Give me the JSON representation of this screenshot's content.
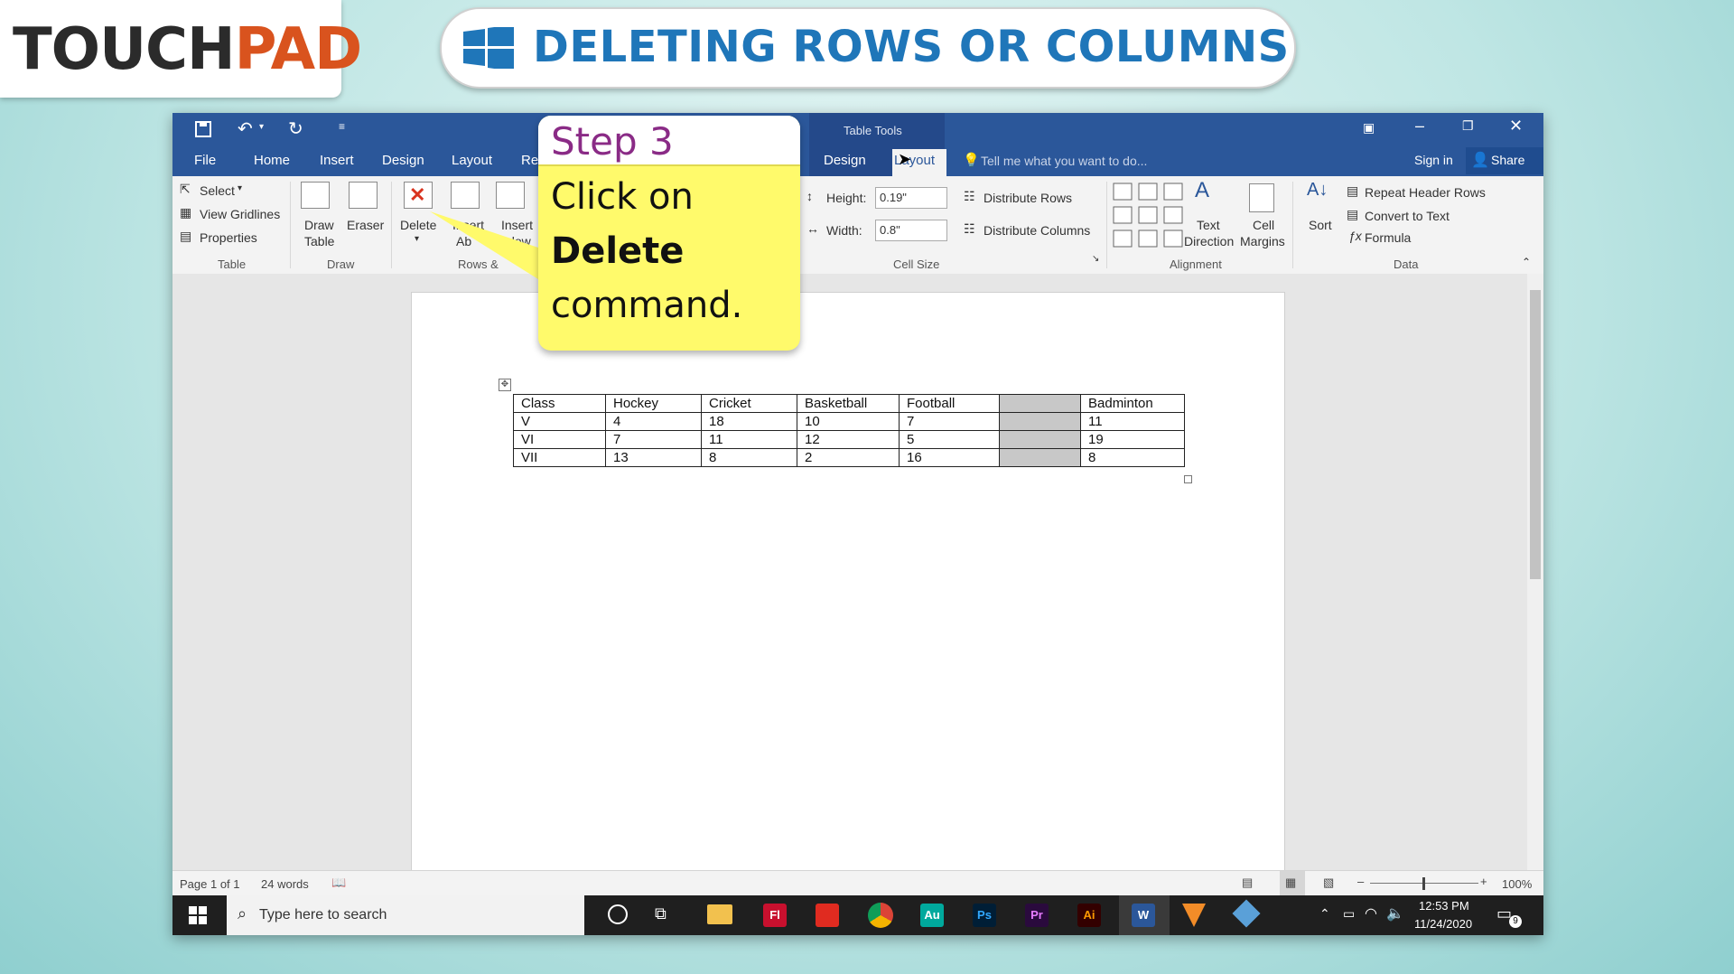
{
  "header": {
    "logo_part1": "TOUCH",
    "logo_part2": "PAD",
    "title": "DELETING ROWS OR COLUMNS"
  },
  "callout": {
    "step": "Step 3",
    "line1": "Click on",
    "line2": "Delete",
    "line3": "command."
  },
  "word": {
    "tabs": [
      "File",
      "Home",
      "Insert",
      "Design",
      "Layout",
      "Re"
    ],
    "table_tools": "Table Tools",
    "tt_tabs": [
      "Design",
      "Layout"
    ],
    "tell_me": "Tell me what you want to do...",
    "sign_in": "Sign in",
    "share": "Share",
    "ribbon": {
      "select": "Select",
      "view_gridlines": "View Gridlines",
      "properties": "Properties",
      "group_table": "Table",
      "draw_table_1": "Draw",
      "draw_table_2": "Table",
      "eraser": "Eraser",
      "group_draw": "Draw",
      "delete": "Delete",
      "insert_above_1": "Insert",
      "insert_above_2": "Ab",
      "insert_below_1": "Insert",
      "insert_below_2": "elow",
      "group_rows": "Rows &",
      "height_label": "Height:",
      "height_value": "0.19\"",
      "width_label": "Width:",
      "width_value": "0.8\"",
      "distribute_rows": "Distribute Rows",
      "distribute_columns": "Distribute Columns",
      "group_cell_size": "Cell Size",
      "text_direction_1": "Text",
      "text_direction_2": "Direction",
      "cell_margins_1": "Cell",
      "cell_margins_2": "Margins",
      "group_alignment": "Alignment",
      "sort": "Sort",
      "repeat_header_rows": "Repeat Header Rows",
      "convert_to_text": "Convert to Text",
      "formula": "Formula",
      "group_data": "Data"
    },
    "table": {
      "header": [
        "Class",
        "Hockey",
        "Cricket",
        "Basketball",
        "Football",
        "",
        "Badminton"
      ],
      "rows": [
        [
          "V",
          "4",
          "18",
          "10",
          "7",
          "",
          "11"
        ],
        [
          "VI",
          "7",
          "11",
          "12",
          "5",
          "",
          "19"
        ],
        [
          "VII",
          "13",
          "8",
          "2",
          "16",
          "",
          "8"
        ]
      ]
    },
    "status": {
      "page": "Page 1 of 1",
      "words": "24 words",
      "zoom": "100%"
    }
  },
  "taskbar": {
    "search_placeholder": "Type here to search",
    "time": "12:53 PM",
    "date": "11/24/2020",
    "notif_count": "9",
    "apps": [
      {
        "label": "Fl",
        "color": "#c8102e"
      },
      {
        "label": "Au",
        "color": "#00a99d"
      },
      {
        "label": "Ps",
        "color": "#001e36"
      },
      {
        "label": "Pr",
        "color": "#2a0a3d"
      },
      {
        "label": "Ai",
        "color": "#330000"
      },
      {
        "label": "W",
        "color": "#2b579a"
      }
    ]
  },
  "colors": {
    "title_blue": "#1f76b9",
    "logo_orange": "#d9531e",
    "word_blue": "#2b579a",
    "callout_yellow": "#fffa6b",
    "step_purple": "#8a2b86"
  }
}
